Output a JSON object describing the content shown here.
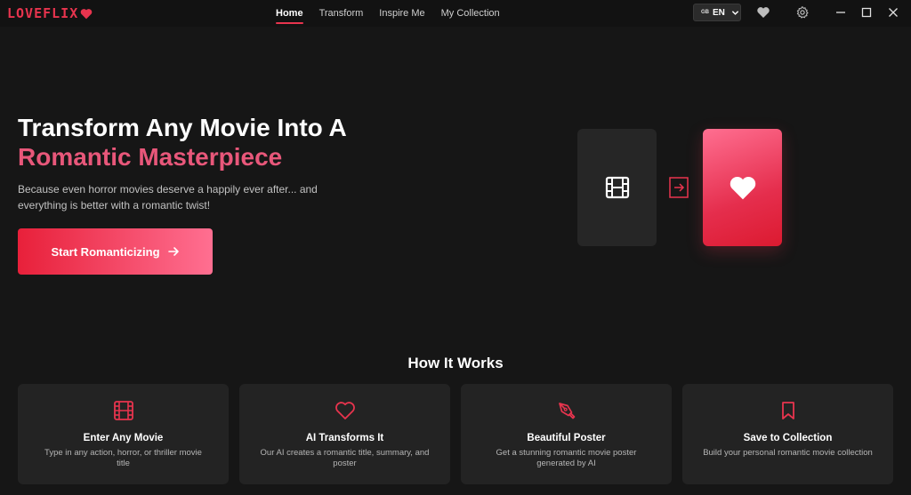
{
  "app": {
    "logo_text": "LOVEFLIX",
    "brand_color": "#e8344e"
  },
  "nav": {
    "items": [
      {
        "label": "Home",
        "active": true
      },
      {
        "label": "Transform",
        "active": false
      },
      {
        "label": "Inspire Me",
        "active": false
      },
      {
        "label": "My Collection",
        "active": false
      }
    ]
  },
  "language": {
    "flag": "GB",
    "code": "EN"
  },
  "header_icons": [
    "heart-icon",
    "gear-icon"
  ],
  "window_controls": [
    "minimize-icon",
    "maximize-icon",
    "close-icon"
  ],
  "hero": {
    "title_line1": "Transform Any Movie Into A",
    "title_line2": "Romantic Masterpiece",
    "subtitle": "Because even horror movies deserve a happily ever after... and everything is better with a romantic twist!",
    "cta_label": "Start Romanticizing"
  },
  "how_it_works": {
    "title": "How It Works",
    "steps": [
      {
        "title": "Enter Any Movie",
        "desc": "Type in any action, horror, or thriller movie title",
        "icon": "film-icon"
      },
      {
        "title": "AI Transforms It",
        "desc": "Our AI creates a romantic title, summary, and poster",
        "icon": "heart-outline-icon"
      },
      {
        "title": "Beautiful Poster",
        "desc": "Get a stunning romantic movie poster generated by AI",
        "icon": "pen-nib-icon"
      },
      {
        "title": "Save to Collection",
        "desc": "Build your personal romantic movie collection",
        "icon": "bookmark-icon"
      }
    ]
  }
}
